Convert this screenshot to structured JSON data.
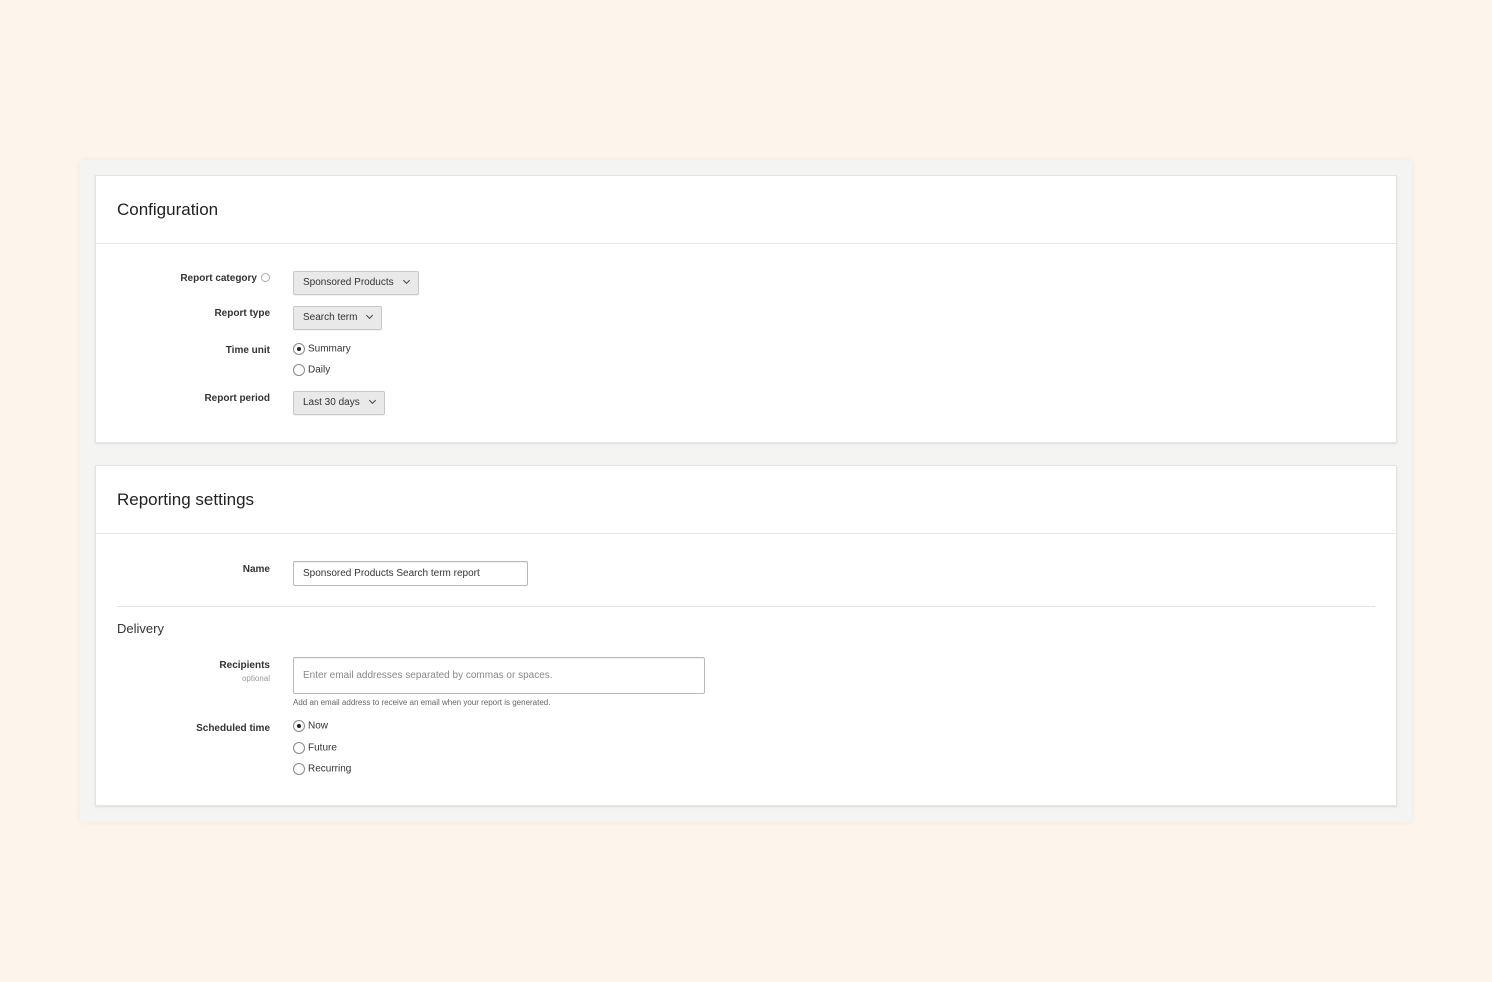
{
  "configuration": {
    "title": "Configuration",
    "report_category": {
      "label": "Report category",
      "value": "Sponsored Products"
    },
    "report_type": {
      "label": "Report type",
      "value": "Search term"
    },
    "time_unit": {
      "label": "Time unit",
      "options": [
        "Summary",
        "Daily"
      ],
      "selected": "Summary"
    },
    "report_period": {
      "label": "Report period",
      "value": "Last 30 days"
    }
  },
  "reporting_settings": {
    "title": "Reporting settings",
    "name": {
      "label": "Name",
      "value": "Sponsored Products Search term report"
    },
    "delivery": {
      "title": "Delivery",
      "recipients": {
        "label": "Recipients",
        "sublabel": "optional",
        "placeholder": "Enter email addresses separated by commas or spaces.",
        "hint": "Add an email address to receive an email when your report is generated."
      },
      "scheduled_time": {
        "label": "Scheduled time",
        "options": [
          "Now",
          "Future",
          "Recurring"
        ],
        "selected": "Now"
      }
    }
  }
}
